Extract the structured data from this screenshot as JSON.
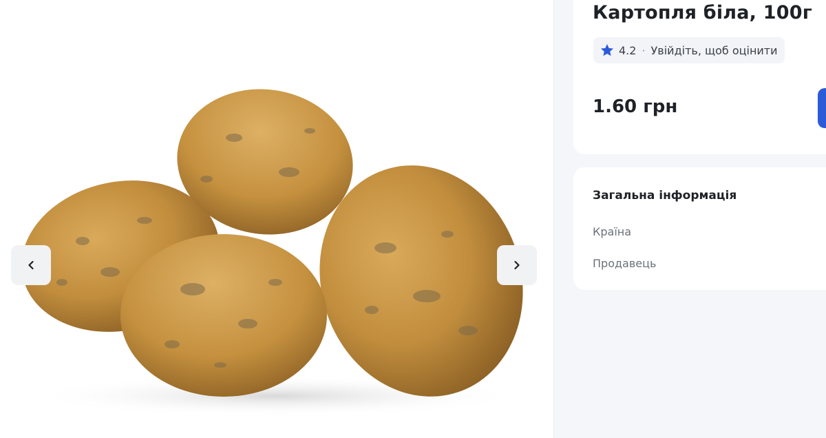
{
  "product": {
    "title": "Картопля біла, 100г",
    "rating": "4.2",
    "rating_separator": "·",
    "rating_prompt": "Увійдіть, щоб оцінити",
    "price": "1.60 грн"
  },
  "gallery": {
    "prev_icon": "chevron-left-icon",
    "next_icon": "chevron-right-icon"
  },
  "info": {
    "heading": "Загальна інформація",
    "rows": [
      {
        "label": "Країна"
      },
      {
        "label": "Продавець"
      }
    ]
  },
  "colors": {
    "accent": "#2c5bd8",
    "star": "#2c5bd8",
    "page_bg": "#f4f6fa",
    "card_bg": "#ffffff",
    "muted_text": "#6b7079"
  }
}
